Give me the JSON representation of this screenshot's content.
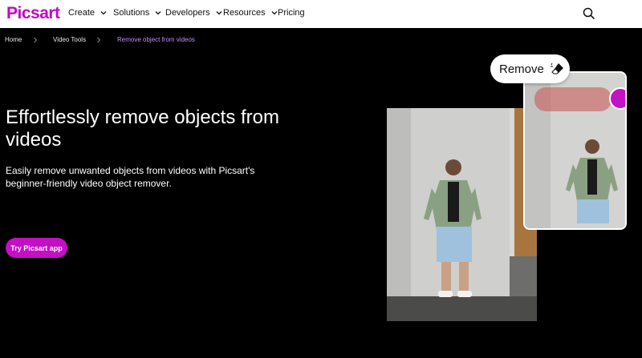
{
  "brand": {
    "logo_text": "Picsart",
    "accent": "#c209c1"
  },
  "nav": {
    "items": [
      {
        "label": "Create",
        "has_dropdown": true
      },
      {
        "label": "Solutions",
        "has_dropdown": true
      },
      {
        "label": "Developers",
        "has_dropdown": true
      },
      {
        "label": "Resources",
        "has_dropdown": true
      },
      {
        "label": "Pricing",
        "has_dropdown": false
      }
    ],
    "search_icon": "search-icon"
  },
  "breadcrumb": {
    "items": [
      {
        "label": "Home"
      },
      {
        "label": "Video Tools"
      },
      {
        "label": "Remove object from videos"
      }
    ]
  },
  "hero": {
    "title": "Effortlessly remove objects from videos",
    "subtitle": "Easily remove unwanted objects from videos with Picsart's beginner-friendly video object remover.",
    "cta_label": "Try Picsart app",
    "cta_color": "#c40fc4"
  },
  "illustration": {
    "remove_label": "Remove",
    "remove_icon": "eraser-icon",
    "brush_color": "#c413c6"
  }
}
